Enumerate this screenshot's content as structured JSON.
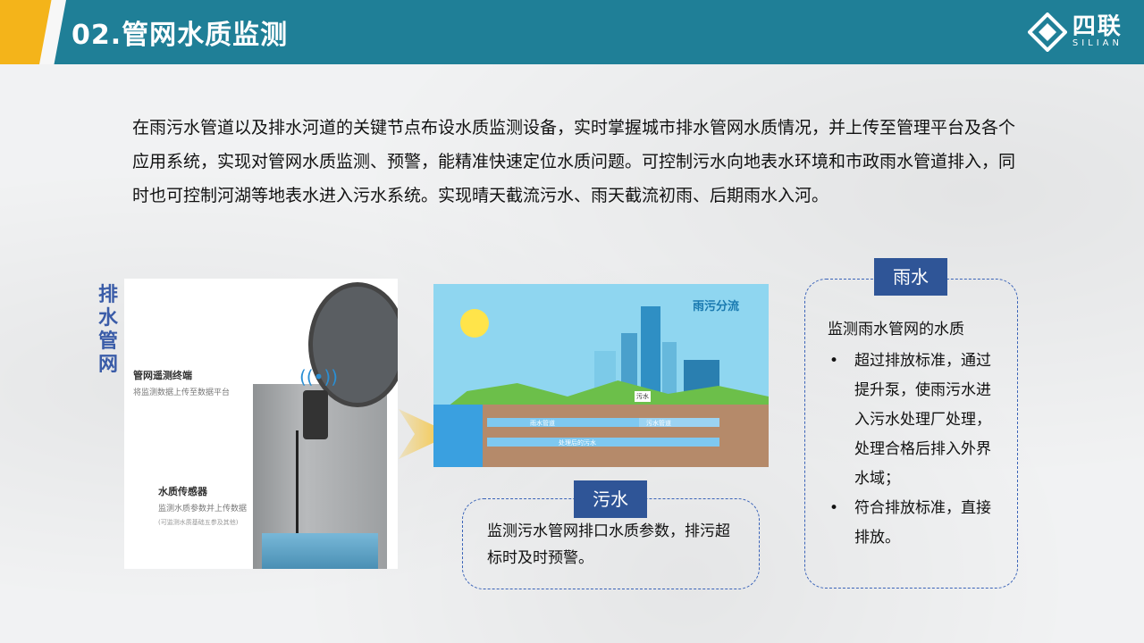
{
  "header": {
    "title": "02.管网水质监测",
    "logo_cn": "四联",
    "logo_en": "SILIAN",
    "accent_color": "#1f7f97",
    "stripe_color": "#f4b41a"
  },
  "intro": "在雨污水管道以及排水河道的关键节点布设水质监测设备，实时掌握城市排水管网水质情况，并上传至管理平台及各个应用系统，实现对管网水质监测、预警，能精准快速定位水质问题。可控制污水向地表水环境和市政雨水管道排入，同时也可控制河湖等地表水进入污水系统。实现晴天截流污水、雨天截流初雨、后期雨水入河。",
  "vertical_label": "排水管网",
  "device": {
    "label1": "管网遥测终端",
    "sub1": "将监测数据上传至数据平台",
    "label2": "水质传感器",
    "sub2": "监测水质参数并上传数据",
    "sub3": "(可监测水质基础五参及其他)"
  },
  "scene": {
    "title": "雨污分流",
    "label_rain_pipe": "雨水管道",
    "label_sewage_pipe": "污水管道",
    "label_sewage": "污水",
    "label_treated": "处理后的污水"
  },
  "sewage": {
    "tag": "污水",
    "text": "监测污水管网排口水质参数，排污超标时及时预警。"
  },
  "rain": {
    "tag": "雨水",
    "heading": "监测雨水管网的水质",
    "items": [
      "超过排放标准，通过提升泵，使雨污水进入污水处理厂处理，处理合格后排入外界水域；",
      "符合排放标准，直接排放。"
    ]
  }
}
